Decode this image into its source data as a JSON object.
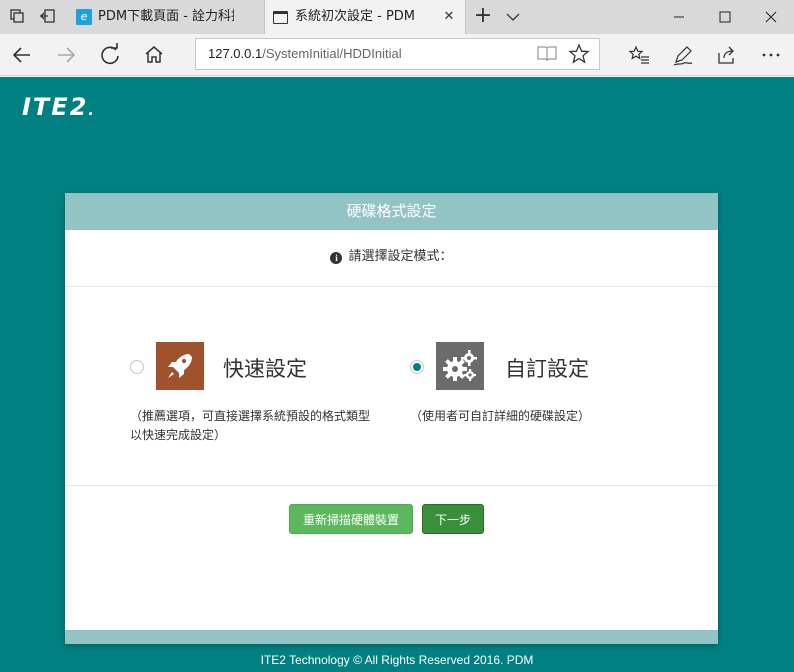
{
  "browser": {
    "tabs": [
      {
        "title": "PDM下載頁面 - 詮力科技ITE"
      },
      {
        "title": "系統初次設定 - PDM"
      }
    ],
    "url": {
      "host": "127.0.0.1",
      "path": "/SystemInitial/HDDInitial"
    }
  },
  "page": {
    "logo_text": "ITE2",
    "logo_dot": ".",
    "card": {
      "header": "硬碟格式設定",
      "prompt": "請選擇設定模式：",
      "options": [
        {
          "label": "快速設定",
          "description": "（推薦選項，可直接選擇系統預設的格式類型以快速完成設定）",
          "selected": false,
          "icon": "rocket-icon",
          "icon_bg": "#a0522d"
        },
        {
          "label": "自訂設定",
          "description": "（使用者可自訂詳細的硬碟設定）",
          "selected": true,
          "icon": "gears-icon",
          "icon_bg": "#6b6b6b"
        }
      ],
      "rescan_button": "重新掃描硬體裝置",
      "next_button": "下一步"
    },
    "footer": "ITE2 Technology © All Rights Reserved 2016. PDM"
  },
  "colors": {
    "page_bg": "#008080",
    "card_header": "#93c4c5",
    "primary_btn": "#5cb85c",
    "accent": "#008080"
  }
}
